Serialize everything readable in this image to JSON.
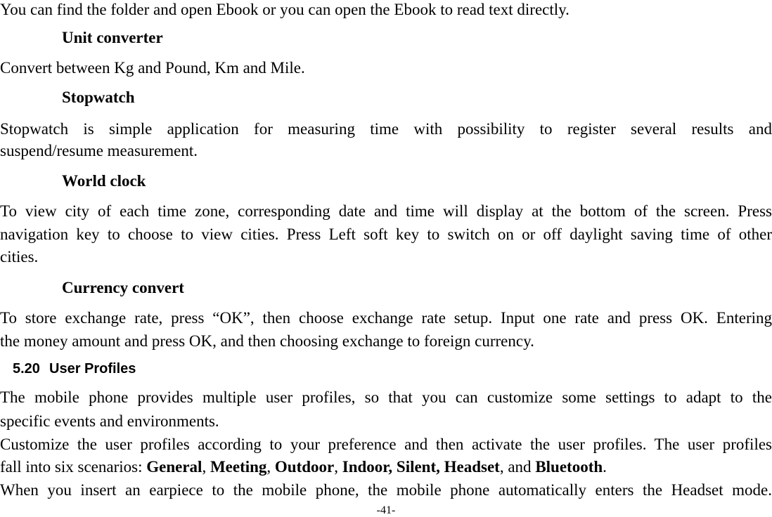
{
  "document": {
    "intro_line": "You can find the folder and open Ebook or you can open the Ebook to read text directly.",
    "sections": [
      {
        "heading": "Unit converter",
        "lines": [
          "Convert between Kg and Pound, Km and Mile."
        ]
      },
      {
        "heading": "Stopwatch",
        "lines": [
          "Stopwatch is simple application for measuring time with possibility to register several results and",
          "suspend/resume measurement."
        ]
      },
      {
        "heading": "World clock",
        "lines": [
          "To view city of each time zone, corresponding date and time will display at the bottom of the screen. Press",
          "navigation key to choose to view cities. Press Left soft key to switch on or off daylight saving time of other",
          "cities."
        ]
      },
      {
        "heading": "Currency convert",
        "lines": [
          "To store exchange rate, press “OK”, then choose exchange rate setup. Input one rate and press OK. Entering",
          "the money amount and press OK, and then choosing exchange to foreign currency."
        ]
      }
    ],
    "chapter": {
      "number": "5.20",
      "title": "User Profiles",
      "paragraph1": [
        "The mobile phone provides multiple user profiles, so that you can customize some settings to adapt to the",
        "specific events and environments."
      ],
      "paragraph2_line1": "Customize the user profiles according to your preference and then activate the user profiles. The user profiles",
      "paragraph2_line2": {
        "prefix": "fall into six scenarios: ",
        "general": "General",
        "sep1": ", ",
        "meeting": "Meeting",
        "sep2": ", ",
        "outdoor": "Outdoor",
        "sep3": ", ",
        "indoor_silent_headset": "Indoor, Silent, Headset",
        "sep4": ", and ",
        "bluetooth": "Bluetooth",
        "end": "."
      },
      "paragraph3": "When you insert an earpiece to the mobile phone, the mobile phone automatically enters the Headset mode."
    },
    "page_number": "-41-"
  }
}
